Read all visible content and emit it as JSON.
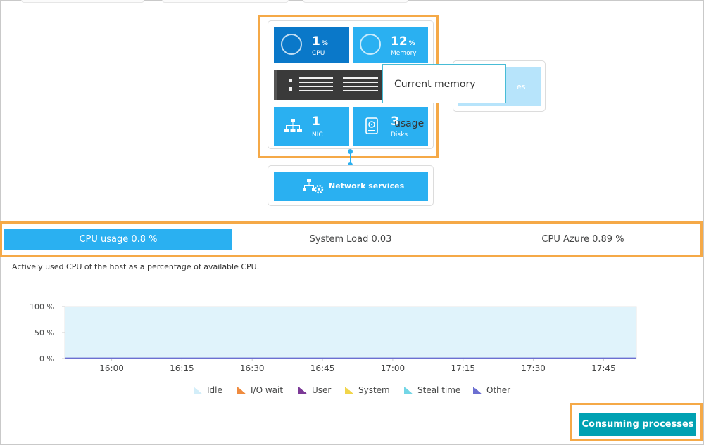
{
  "host": {
    "cpu": {
      "value": "1",
      "unit": "%",
      "label": "CPU"
    },
    "memory": {
      "value": "12",
      "unit": "%",
      "label": "Memory"
    },
    "nic": {
      "value": "1",
      "label": "NIC"
    },
    "disks": {
      "value": "3",
      "label": "Disks"
    }
  },
  "side_tile": {
    "label_fragment": "es"
  },
  "tooltip": {
    "text": "Current memory usage"
  },
  "network_services": {
    "label": "Network services"
  },
  "tabs": [
    {
      "label": "CPU usage 0.8 %"
    },
    {
      "label": "System Load 0.03"
    },
    {
      "label": "CPU Azure 0.89 %"
    }
  ],
  "description": "Actively used CPU of the host as a percentage of available CPU.",
  "chart_data": {
    "type": "area",
    "title": "",
    "xlabel": "",
    "ylabel": "",
    "x_ticks": [
      "16:00",
      "16:15",
      "16:30",
      "16:45",
      "17:00",
      "17:15",
      "17:30",
      "17:45"
    ],
    "y_ticks": [
      "100 %",
      "50 %",
      "0 %"
    ],
    "ylim": [
      0,
      100
    ],
    "grid": true,
    "legend_position": "bottom",
    "x": [
      "15:50",
      "16:00",
      "16:15",
      "16:30",
      "16:45",
      "17:00",
      "17:15",
      "17:30",
      "17:45",
      "17:52"
    ],
    "series": [
      {
        "name": "Idle",
        "color": "#d3eef9",
        "values": [
          99.2,
          99.2,
          99.2,
          99.2,
          99.2,
          99.2,
          99.2,
          99.2,
          99.2,
          99.2
        ]
      },
      {
        "name": "I/O wait",
        "color": "#ef8b3f",
        "values": [
          0,
          0,
          0,
          0,
          0,
          0,
          0,
          0,
          0,
          0
        ]
      },
      {
        "name": "User",
        "color": "#7c3a97",
        "values": [
          0.5,
          0.5,
          0.5,
          0.5,
          0.5,
          0.5,
          0.5,
          0.5,
          0.5,
          0.5
        ]
      },
      {
        "name": "System",
        "color": "#f1d54a",
        "values": [
          0.3,
          0.3,
          0.3,
          0.3,
          0.3,
          0.3,
          0.3,
          0.3,
          0.3,
          0.3
        ]
      },
      {
        "name": "Steal time",
        "color": "#73d6e6",
        "values": [
          0,
          0,
          0,
          0,
          0,
          0,
          0,
          0,
          0,
          0
        ]
      },
      {
        "name": "Other",
        "color": "#6c6fd1",
        "values": [
          0,
          0,
          0,
          0,
          0,
          0,
          0,
          0,
          0,
          0
        ]
      }
    ]
  },
  "consuming_processes": {
    "label": "Consuming processes"
  }
}
